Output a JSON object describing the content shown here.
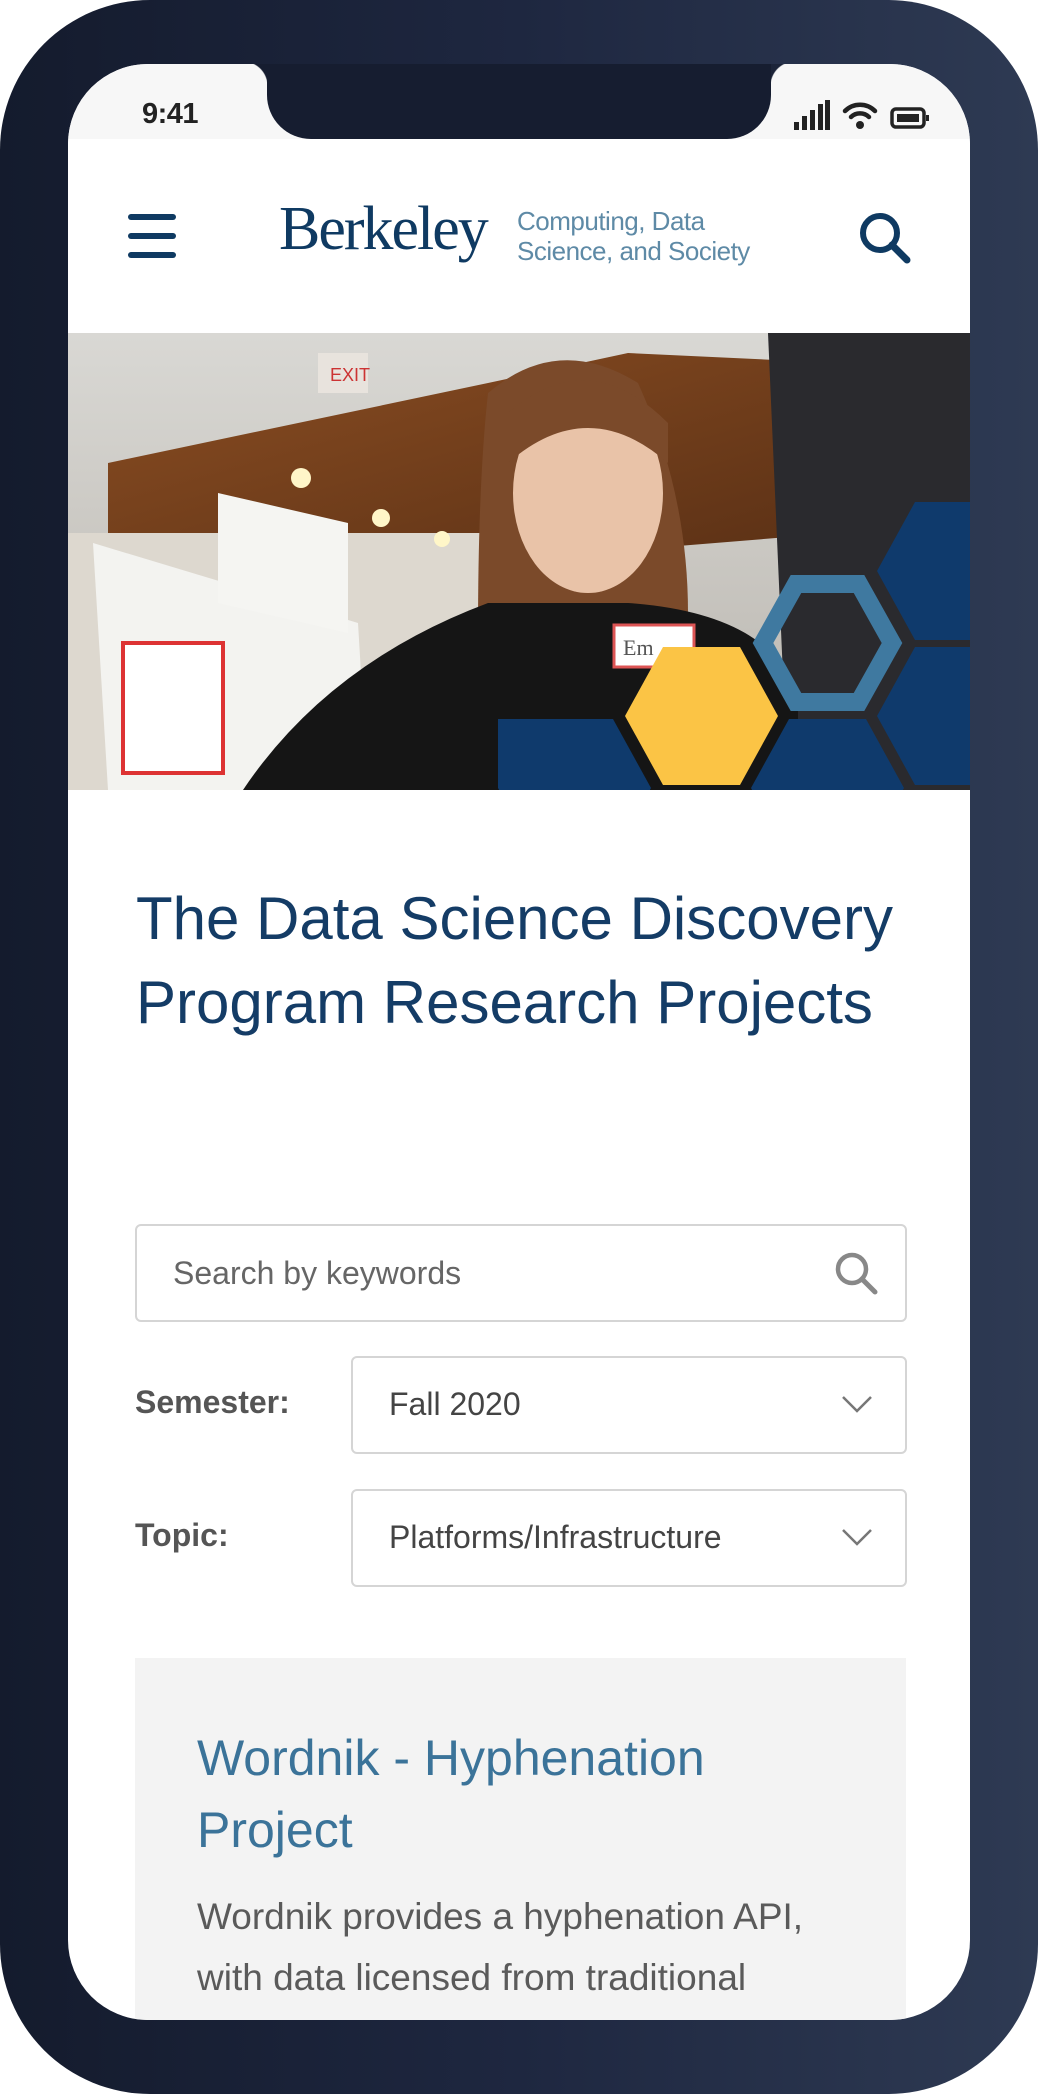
{
  "status_bar": {
    "time": "9:41",
    "icons": [
      "cellular-signal-icon",
      "wifi-icon",
      "battery-icon"
    ]
  },
  "header": {
    "menu_icon": "hamburger-menu-icon",
    "logo": "Berkeley",
    "tagline_line1": "Computing, Data",
    "tagline_line2": "Science, and Society",
    "search_icon": "search-icon"
  },
  "hero": {
    "nametag": "Em"
  },
  "page": {
    "title": "The Data Science Discovery Program Research Projects"
  },
  "filters": {
    "search_placeholder": "Search by keywords",
    "semester_label": "Semester:",
    "semester_value": "Fall 2020",
    "topic_label": "Topic:",
    "topic_value": "Platforms/Infrastructure"
  },
  "projects": [
    {
      "title": "Wordnik - Hyphenation Project",
      "description": "Wordnik provides a hyphenation API, with data licensed from traditional dictionaries. However"
    }
  ],
  "colors": {
    "navy": "#0f3a62",
    "link": "#3b7399",
    "gold": "#fbc445",
    "hex_blue": "#0f3a6c",
    "hex_outline": "#3f79a0",
    "card_bg": "#f3f3f3"
  }
}
